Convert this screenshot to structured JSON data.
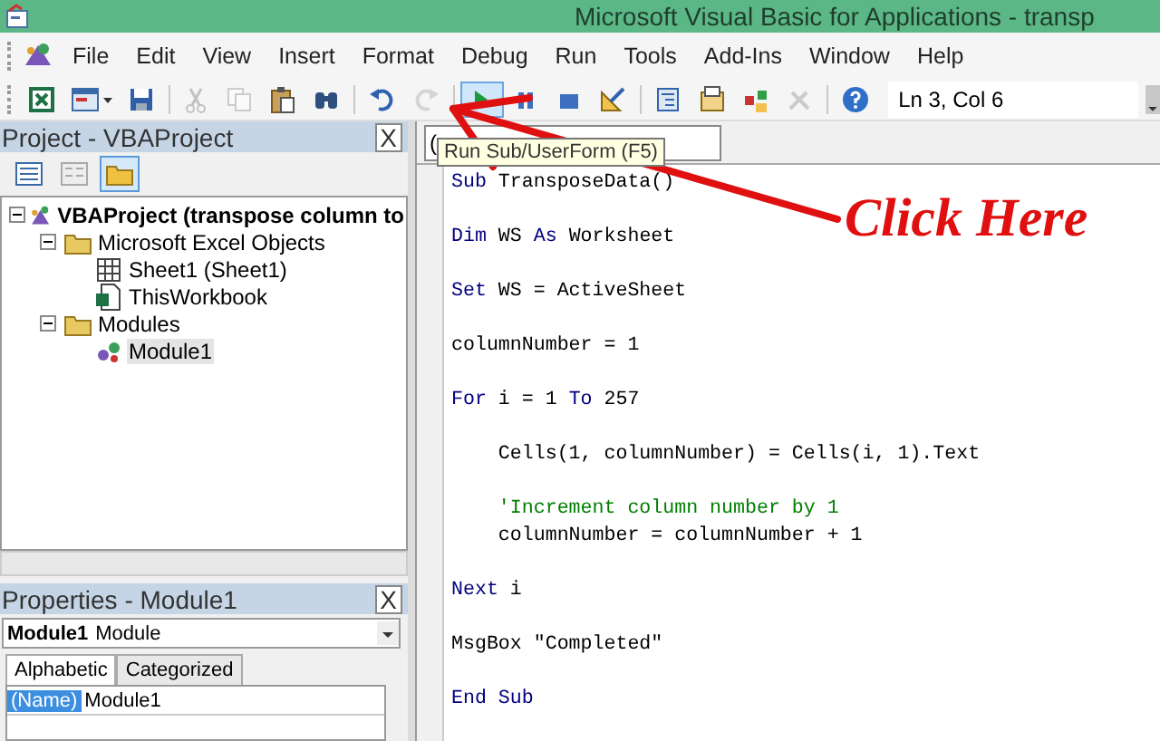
{
  "window": {
    "title": "Microsoft Visual Basic for Applications - transp"
  },
  "menu": [
    "File",
    "Edit",
    "View",
    "Insert",
    "Format",
    "Debug",
    "Run",
    "Tools",
    "Add-Ins",
    "Window",
    "Help"
  ],
  "toolbar": {
    "buttons": [
      {
        "kind": "excel",
        "disabled": false,
        "hovered": false
      },
      {
        "kind": "userform",
        "disabled": false,
        "hovered": false
      },
      {
        "kind": "save",
        "disabled": false,
        "hovered": false
      },
      {
        "kind": "sep"
      },
      {
        "kind": "cut",
        "disabled": true,
        "hovered": false
      },
      {
        "kind": "copy",
        "disabled": true,
        "hovered": false
      },
      {
        "kind": "paste",
        "disabled": false,
        "hovered": false
      },
      {
        "kind": "find",
        "disabled": false,
        "hovered": false
      },
      {
        "kind": "sep"
      },
      {
        "kind": "undo",
        "disabled": false,
        "hovered": false
      },
      {
        "kind": "redo",
        "disabled": true,
        "hovered": false
      },
      {
        "kind": "sep"
      },
      {
        "kind": "run",
        "disabled": false,
        "hovered": true
      },
      {
        "kind": "pause",
        "disabled": false,
        "hovered": false
      },
      {
        "kind": "stop",
        "disabled": false,
        "hovered": false
      },
      {
        "kind": "design",
        "disabled": false,
        "hovered": false
      },
      {
        "kind": "sep"
      },
      {
        "kind": "project",
        "disabled": false,
        "hovered": false
      },
      {
        "kind": "properties",
        "disabled": false,
        "hovered": false
      },
      {
        "kind": "browser",
        "disabled": false,
        "hovered": false
      },
      {
        "kind": "toolbox",
        "disabled": true,
        "hovered": false
      },
      {
        "kind": "sep"
      },
      {
        "kind": "help",
        "disabled": false,
        "hovered": false
      }
    ],
    "position": "Ln 3, Col 6"
  },
  "project": {
    "title": "Project - VBAProject",
    "close": "X",
    "buttons": [
      {
        "kind": "view_code",
        "pressed": false
      },
      {
        "kind": "view_object",
        "pressed": false
      },
      {
        "kind": "toggle_folders",
        "pressed": true
      }
    ],
    "tree": [
      {
        "label": "VBAProject (transpose column to",
        "kind": "project",
        "expanded": true,
        "selected": false,
        "children": [
          {
            "label": "Microsoft Excel Objects",
            "kind": "folder",
            "expanded": true,
            "selected": false,
            "children": [
              {
                "label": "Sheet1 (Sheet1)",
                "kind": "sheet",
                "selected": false
              },
              {
                "label": "ThisWorkbook",
                "kind": "workbook",
                "selected": false
              }
            ]
          },
          {
            "label": "Modules",
            "kind": "folder",
            "expanded": true,
            "selected": false,
            "children": [
              {
                "label": "Module1",
                "kind": "module",
                "selected": true
              }
            ]
          }
        ]
      }
    ]
  },
  "properties": {
    "title": "Properties - Module1",
    "close": "X",
    "object_name": "Module1",
    "object_type": "Module",
    "tabs": [
      {
        "label": "Alphabetic",
        "selected": true
      },
      {
        "label": "Categorized",
        "selected": false
      }
    ],
    "rows": [
      {
        "name": "(Name)",
        "value": "Module1",
        "selected": true
      }
    ]
  },
  "code": {
    "object_combo": "(",
    "tooltip": "Run Sub/UserForm (F5)",
    "blocks": [
      [
        [
          {
            "kind": "keyword",
            "text": "Sub"
          },
          {
            "kind": "plain",
            "text": " TransposeData()"
          }
        ]
      ],
      [
        [
          {
            "kind": "keyword",
            "text": "Dim"
          },
          {
            "kind": "plain",
            "text": " WS "
          },
          {
            "kind": "keyword",
            "text": "As"
          },
          {
            "kind": "plain",
            "text": " Worksheet"
          }
        ]
      ],
      [
        [
          {
            "kind": "keyword",
            "text": "Set"
          },
          {
            "kind": "plain",
            "text": " WS = ActiveSheet"
          }
        ]
      ],
      [
        [
          {
            "kind": "plain",
            "text": "columnNumber = 1"
          }
        ]
      ],
      [
        [
          {
            "kind": "keyword",
            "text": "For"
          },
          {
            "kind": "plain",
            "text": " i = 1 "
          },
          {
            "kind": "keyword",
            "text": "To"
          },
          {
            "kind": "plain",
            "text": " 257"
          }
        ]
      ],
      [
        [
          {
            "kind": "plain",
            "text": "    Cells(1, columnNumber) = Cells(i, 1).Text"
          }
        ]
      ],
      [
        [
          {
            "kind": "comment",
            "text": "    'Increment column number by 1"
          }
        ],
        [
          {
            "kind": "plain",
            "text": "    columnNumber = columnNumber + 1"
          }
        ]
      ],
      [
        [
          {
            "kind": "keyword",
            "text": "Next"
          },
          {
            "kind": "plain",
            "text": " i"
          }
        ]
      ],
      [
        [
          {
            "kind": "plain",
            "text": "MsgBox \"Completed\""
          }
        ]
      ],
      [
        [
          {
            "kind": "keyword",
            "text": "End Sub"
          }
        ]
      ]
    ]
  },
  "annotation": {
    "text": "Click Here"
  }
}
